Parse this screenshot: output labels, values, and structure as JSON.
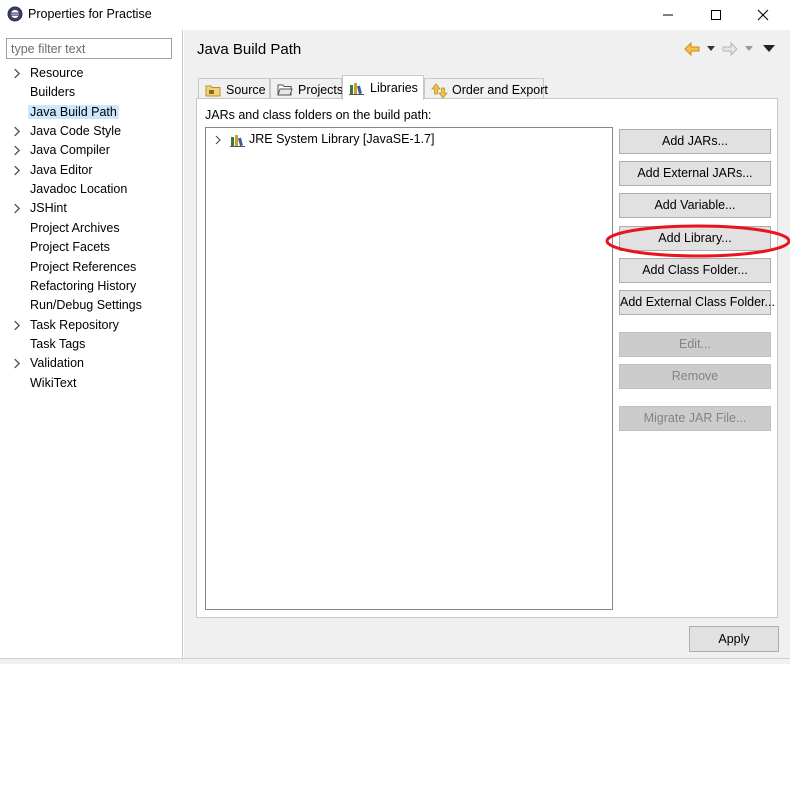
{
  "window": {
    "title": "Properties for Practise"
  },
  "sidebar": {
    "filter_placeholder": "type filter text",
    "items": [
      {
        "label": "Resource",
        "expandable": true
      },
      {
        "label": "Builders",
        "expandable": false
      },
      {
        "label": "Java Build Path",
        "expandable": false,
        "selected": true
      },
      {
        "label": "Java Code Style",
        "expandable": true
      },
      {
        "label": "Java Compiler",
        "expandable": true
      },
      {
        "label": "Java Editor",
        "expandable": true
      },
      {
        "label": "Javadoc Location",
        "expandable": false
      },
      {
        "label": "JSHint",
        "expandable": true
      },
      {
        "label": "Project Archives",
        "expandable": false
      },
      {
        "label": "Project Facets",
        "expandable": false
      },
      {
        "label": "Project References",
        "expandable": false
      },
      {
        "label": "Refactoring History",
        "expandable": false
      },
      {
        "label": "Run/Debug Settings",
        "expandable": false
      },
      {
        "label": "Task Repository",
        "expandable": true
      },
      {
        "label": "Task Tags",
        "expandable": false
      },
      {
        "label": "Validation",
        "expandable": true
      },
      {
        "label": "WikiText",
        "expandable": false
      }
    ]
  },
  "main": {
    "title": "Java Build Path",
    "tabs": [
      {
        "label": "Source",
        "icon": "source-folder-icon"
      },
      {
        "label": "Projects",
        "icon": "projects-folder-icon"
      },
      {
        "label": "Libraries",
        "icon": "libraries-icon",
        "active": true
      },
      {
        "label": "Order and Export",
        "icon": "order-export-icon"
      }
    ],
    "build_path_label": "JARs and class folders on the build path:",
    "libraries": [
      {
        "label": "JRE System Library [JavaSE-1.7]",
        "icon": "jre-library-icon"
      }
    ],
    "buttons": {
      "add_jars": "Add JARs...",
      "add_external_jars": "Add External JARs...",
      "add_variable": "Add Variable...",
      "add_library": "Add Library...",
      "add_class_folder": "Add Class Folder...",
      "add_external_class_folder": "Add External Class Folder...",
      "edit": "Edit...",
      "remove": "Remove",
      "migrate_jar": "Migrate JAR File..."
    },
    "apply_label": "Apply"
  },
  "colors": {
    "selection": "#cce8ff",
    "highlight_ellipse": "#e8141e",
    "nav_arrow": "#e8a21a"
  }
}
